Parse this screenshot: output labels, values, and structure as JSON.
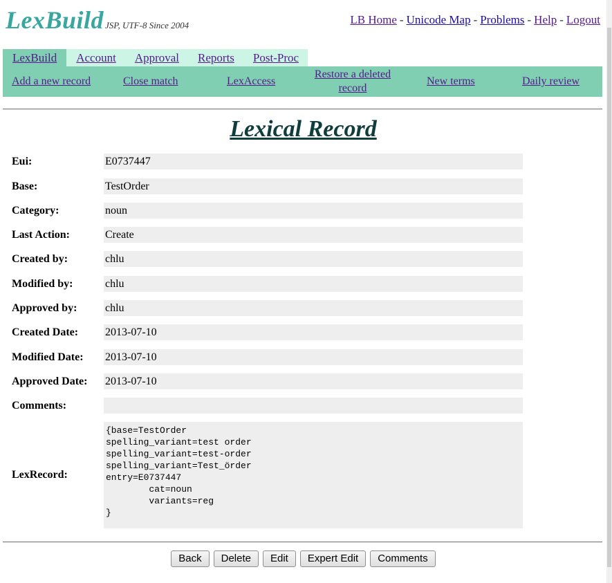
{
  "header": {
    "logo_text": "LexBuild",
    "logo_tagline": "JSP, UTF-8 Since 2004",
    "links": [
      "LB Home",
      "Unicode Map",
      "Problems",
      "Help",
      "Logout"
    ],
    "separator": "-"
  },
  "tabs": [
    "LexBuild",
    "Account",
    "Approval",
    "Reports",
    "Post-Proc"
  ],
  "subnav": {
    "add_new_record": "Add a new record",
    "close_match": "Close match",
    "lexaccess": "LexAccess",
    "restore_line1": "Restore a deleted",
    "restore_line2": "record",
    "new_terms": "New terms",
    "daily_review": "Daily review"
  },
  "page_title": "Lexical Record",
  "record": {
    "eui": {
      "label": "Eui:",
      "value": "E0737447"
    },
    "base": {
      "label": "Base:",
      "value": "TestOrder"
    },
    "category": {
      "label": "Category:",
      "value": "noun"
    },
    "last_action": {
      "label": "Last Action:",
      "value": "Create"
    },
    "created_by": {
      "label": "Created by:",
      "value": "chlu"
    },
    "modified_by": {
      "label": "Modified by:",
      "value": "chlu"
    },
    "approved_by": {
      "label": "Approved by:",
      "value": "chlu"
    },
    "created_date": {
      "label": "Created Date:",
      "value": "2013-07-10"
    },
    "modified_date": {
      "label": "Modified Date:",
      "value": "2013-07-10"
    },
    "approved_date": {
      "label": "Approved Date:",
      "value": "2013-07-10"
    },
    "comments": {
      "label": "Comments:",
      "value": ""
    },
    "lexrecord": {
      "label": "LexRecord:",
      "value": "{base=TestOrder\nspelling_variant=test order\nspelling_variant=test-order\nspelling_variant=Test_örder\nentry=E0737447\n\tcat=noun\n\tvariants=reg\n}"
    }
  },
  "buttons": {
    "back": "Back",
    "delete": "Delete",
    "edit": "Edit",
    "expert_edit": "Expert Edit",
    "comments": "Comments"
  }
}
